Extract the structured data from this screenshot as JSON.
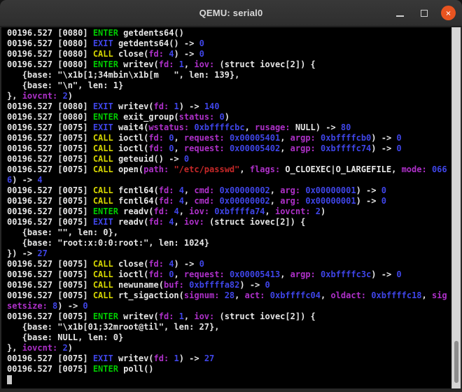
{
  "window": {
    "title": "QEMU: serial0",
    "controls": {
      "minimize": "minimize",
      "maximize": "maximize",
      "close_glyph": "✕"
    }
  },
  "colors": {
    "terminal_background": "#000000",
    "titlebar": "#2e2e2e",
    "text_default": "#e6e6e6",
    "enter_green": "#00cb00",
    "exit_blue": "#3f45e8",
    "call_yellow": "#d4d400",
    "param_magenta": "#ae30c9",
    "string_red": "#c62828",
    "close_button": "#e95420",
    "scrollbar_track": "#d6d6d6",
    "scrollbar_thumb": "#8e8e8e",
    "cursor": "#c9c9c9"
  },
  "terminal": {
    "cursor_visible": true,
    "lines": [
      [
        [
          "w",
          "00196.527 [0080] "
        ],
        [
          "g",
          "ENTER"
        ],
        [
          "w",
          " getdents64()"
        ]
      ],
      [
        [
          "w",
          "00196.527 [0080] "
        ],
        [
          "b",
          "EXIT"
        ],
        [
          "w",
          " getdents64() -> "
        ],
        [
          "b",
          "0"
        ]
      ],
      [
        [
          "w",
          "00196.527 [0080] "
        ],
        [
          "y",
          "CALL"
        ],
        [
          "w",
          " close("
        ],
        [
          "m",
          "fd:"
        ],
        [
          "w",
          " "
        ],
        [
          "b",
          "4"
        ],
        [
          "w",
          ") -> "
        ],
        [
          "b",
          "0"
        ]
      ],
      [
        [
          "w",
          "00196.527 [0080] "
        ],
        [
          "g",
          "ENTER"
        ],
        [
          "w",
          " writev("
        ],
        [
          "m",
          "fd:"
        ],
        [
          "w",
          " "
        ],
        [
          "b",
          "1"
        ],
        [
          "w",
          ", "
        ],
        [
          "m",
          "iov:"
        ],
        [
          "w",
          " (struct iovec[2]) {"
        ]
      ],
      [
        [
          "w",
          "   {base: \"\\x1b[1;34mbin\\x1b[m   \", len: 139},"
        ]
      ],
      [
        [
          "w",
          "   {base: \"\\n\", len: 1}"
        ]
      ],
      [
        [
          "w",
          "}, "
        ],
        [
          "m",
          "iovcnt:"
        ],
        [
          "w",
          " "
        ],
        [
          "b",
          "2"
        ],
        [
          "w",
          ")"
        ]
      ],
      [
        [
          "w",
          "00196.527 [0080] "
        ],
        [
          "b",
          "EXIT"
        ],
        [
          "w",
          " writev("
        ],
        [
          "m",
          "fd:"
        ],
        [
          "w",
          " "
        ],
        [
          "b",
          "1"
        ],
        [
          "w",
          ") -> "
        ],
        [
          "b",
          "140"
        ]
      ],
      [
        [
          "w",
          "00196.527 [0080] "
        ],
        [
          "g",
          "ENTER"
        ],
        [
          "w",
          " exit_group("
        ],
        [
          "m",
          "status:"
        ],
        [
          "w",
          " "
        ],
        [
          "b",
          "0"
        ],
        [
          "w",
          ")"
        ]
      ],
      [
        [
          "w",
          "00196.527 [0075] "
        ],
        [
          "b",
          "EXIT"
        ],
        [
          "w",
          " wait4("
        ],
        [
          "m",
          "wstatus:"
        ],
        [
          "w",
          " "
        ],
        [
          "b",
          "0xbffffcbc"
        ],
        [
          "w",
          ", "
        ],
        [
          "m",
          "rusage:"
        ],
        [
          "w",
          " NULL) -> "
        ],
        [
          "b",
          "80"
        ]
      ],
      [
        [
          "w",
          "00196.527 [0075] "
        ],
        [
          "y",
          "CALL"
        ],
        [
          "w",
          " ioctl("
        ],
        [
          "m",
          "fd:"
        ],
        [
          "w",
          " "
        ],
        [
          "b",
          "0"
        ],
        [
          "w",
          ", "
        ],
        [
          "m",
          "request:"
        ],
        [
          "w",
          " "
        ],
        [
          "b",
          "0x00005401"
        ],
        [
          "w",
          ", "
        ],
        [
          "m",
          "argp:"
        ],
        [
          "w",
          " "
        ],
        [
          "b",
          "0xbffffcb0"
        ],
        [
          "w",
          ") -> "
        ],
        [
          "b",
          "0"
        ]
      ],
      [
        [
          "w",
          "00196.527 [0075] "
        ],
        [
          "y",
          "CALL"
        ],
        [
          "w",
          " ioctl("
        ],
        [
          "m",
          "fd:"
        ],
        [
          "w",
          " "
        ],
        [
          "b",
          "0"
        ],
        [
          "w",
          ", "
        ],
        [
          "m",
          "request:"
        ],
        [
          "w",
          " "
        ],
        [
          "b",
          "0x00005402"
        ],
        [
          "w",
          ", "
        ],
        [
          "m",
          "argp:"
        ],
        [
          "w",
          " "
        ],
        [
          "b",
          "0xbffffc74"
        ],
        [
          "w",
          ") -> "
        ],
        [
          "b",
          "0"
        ]
      ],
      [
        [
          "w",
          "00196.527 [0075] "
        ],
        [
          "y",
          "CALL"
        ],
        [
          "w",
          " geteuid() -> "
        ],
        [
          "b",
          "0"
        ]
      ],
      [
        [
          "w",
          "00196.527 [0075] "
        ],
        [
          "y",
          "CALL"
        ],
        [
          "w",
          " open("
        ],
        [
          "m",
          "path:"
        ],
        [
          "w",
          " "
        ],
        [
          "r",
          "\"/etc/passwd\""
        ],
        [
          "w",
          ", "
        ],
        [
          "m",
          "flags:"
        ],
        [
          "w",
          " O_CLOEXEC|O_LARGEFILE, "
        ],
        [
          "m",
          "mode:"
        ],
        [
          "w",
          " "
        ],
        [
          "b",
          "066"
        ]
      ],
      [
        [
          "b",
          "6"
        ],
        [
          "w",
          ") -> "
        ],
        [
          "b",
          "4"
        ]
      ],
      [
        [
          "w",
          "00196.527 [0075] "
        ],
        [
          "y",
          "CALL"
        ],
        [
          "w",
          " fcntl64("
        ],
        [
          "m",
          "fd:"
        ],
        [
          "w",
          " "
        ],
        [
          "b",
          "4"
        ],
        [
          "w",
          ", "
        ],
        [
          "m",
          "cmd:"
        ],
        [
          "w",
          " "
        ],
        [
          "b",
          "0x00000002"
        ],
        [
          "w",
          ", "
        ],
        [
          "m",
          "arg:"
        ],
        [
          "w",
          " "
        ],
        [
          "b",
          "0x00000001"
        ],
        [
          "w",
          ") -> "
        ],
        [
          "b",
          "0"
        ]
      ],
      [
        [
          "w",
          "00196.527 [0075] "
        ],
        [
          "y",
          "CALL"
        ],
        [
          "w",
          " fcntl64("
        ],
        [
          "m",
          "fd:"
        ],
        [
          "w",
          " "
        ],
        [
          "b",
          "4"
        ],
        [
          "w",
          ", "
        ],
        [
          "m",
          "cmd:"
        ],
        [
          "w",
          " "
        ],
        [
          "b",
          "0x00000002"
        ],
        [
          "w",
          ", "
        ],
        [
          "m",
          "arg:"
        ],
        [
          "w",
          " "
        ],
        [
          "b",
          "0x00000001"
        ],
        [
          "w",
          ") -> "
        ],
        [
          "b",
          "0"
        ]
      ],
      [
        [
          "w",
          "00196.527 [0075] "
        ],
        [
          "g",
          "ENTER"
        ],
        [
          "w",
          " readv("
        ],
        [
          "m",
          "fd:"
        ],
        [
          "w",
          " "
        ],
        [
          "b",
          "4"
        ],
        [
          "w",
          ", "
        ],
        [
          "m",
          "iov:"
        ],
        [
          "w",
          " "
        ],
        [
          "b",
          "0xbffffa74"
        ],
        [
          "w",
          ", "
        ],
        [
          "m",
          "iovcnt:"
        ],
        [
          "w",
          " "
        ],
        [
          "b",
          "2"
        ],
        [
          "w",
          ")"
        ]
      ],
      [
        [
          "w",
          "00196.527 [0075] "
        ],
        [
          "b",
          "EXIT"
        ],
        [
          "w",
          " readv("
        ],
        [
          "m",
          "fd:"
        ],
        [
          "w",
          " "
        ],
        [
          "b",
          "4"
        ],
        [
          "w",
          ", "
        ],
        [
          "m",
          "iov:"
        ],
        [
          "w",
          " (struct iovec[2]) {"
        ]
      ],
      [
        [
          "w",
          "   {base: \"\", len: 0},"
        ]
      ],
      [
        [
          "w",
          "   {base: \"root:x:0:0:root:\", len: 1024}"
        ]
      ],
      [
        [
          "w",
          "}) -> "
        ],
        [
          "b",
          "27"
        ]
      ],
      [
        [
          "w",
          "00196.527 [0075] "
        ],
        [
          "y",
          "CALL"
        ],
        [
          "w",
          " close("
        ],
        [
          "m",
          "fd:"
        ],
        [
          "w",
          " "
        ],
        [
          "b",
          "4"
        ],
        [
          "w",
          ") -> "
        ],
        [
          "b",
          "0"
        ]
      ],
      [
        [
          "w",
          "00196.527 [0075] "
        ],
        [
          "y",
          "CALL"
        ],
        [
          "w",
          " ioctl("
        ],
        [
          "m",
          "fd:"
        ],
        [
          "w",
          " "
        ],
        [
          "b",
          "0"
        ],
        [
          "w",
          ", "
        ],
        [
          "m",
          "request:"
        ],
        [
          "w",
          " "
        ],
        [
          "b",
          "0x00005413"
        ],
        [
          "w",
          ", "
        ],
        [
          "m",
          "argp:"
        ],
        [
          "w",
          " "
        ],
        [
          "b",
          "0xbffffc3c"
        ],
        [
          "w",
          ") -> "
        ],
        [
          "b",
          "0"
        ]
      ],
      [
        [
          "w",
          "00196.527 [0075] "
        ],
        [
          "y",
          "CALL"
        ],
        [
          "w",
          " newuname("
        ],
        [
          "m",
          "buf:"
        ],
        [
          "w",
          " "
        ],
        [
          "b",
          "0xbffffa82"
        ],
        [
          "w",
          ") -> "
        ],
        [
          "b",
          "0"
        ]
      ],
      [
        [
          "w",
          "00196.527 [0075] "
        ],
        [
          "y",
          "CALL"
        ],
        [
          "w",
          " rt_sigaction("
        ],
        [
          "m",
          "signum:"
        ],
        [
          "w",
          " "
        ],
        [
          "b",
          "28"
        ],
        [
          "w",
          ", "
        ],
        [
          "m",
          "act:"
        ],
        [
          "w",
          " "
        ],
        [
          "b",
          "0xbffffc04"
        ],
        [
          "w",
          ", "
        ],
        [
          "m",
          "oldact:"
        ],
        [
          "w",
          " "
        ],
        [
          "b",
          "0xbffffc18"
        ],
        [
          "w",
          ", "
        ],
        [
          "m",
          "sig"
        ]
      ],
      [
        [
          "m",
          "setsize:"
        ],
        [
          "w",
          " "
        ],
        [
          "b",
          "8"
        ],
        [
          "w",
          ") -> "
        ],
        [
          "b",
          "0"
        ]
      ],
      [
        [
          "w",
          "00196.527 [0075] "
        ],
        [
          "g",
          "ENTER"
        ],
        [
          "w",
          " writev("
        ],
        [
          "m",
          "fd:"
        ],
        [
          "w",
          " "
        ],
        [
          "b",
          "1"
        ],
        [
          "w",
          ", "
        ],
        [
          "m",
          "iov:"
        ],
        [
          "w",
          " (struct iovec[2]) {"
        ]
      ],
      [
        [
          "w",
          "   {base: \"\\x1b[01;32mroot@til\", len: 27},"
        ]
      ],
      [
        [
          "w",
          "   {base: NULL, len: 0}"
        ]
      ],
      [
        [
          "w",
          "}, "
        ],
        [
          "m",
          "iovcnt:"
        ],
        [
          "w",
          " "
        ],
        [
          "b",
          "2"
        ],
        [
          "w",
          ")"
        ]
      ],
      [
        [
          "w",
          "00196.527 [0075] "
        ],
        [
          "b",
          "EXIT"
        ],
        [
          "w",
          " writev("
        ],
        [
          "m",
          "fd:"
        ],
        [
          "w",
          " "
        ],
        [
          "b",
          "1"
        ],
        [
          "w",
          ") -> "
        ],
        [
          "b",
          "27"
        ]
      ],
      [
        [
          "w",
          "00196.527 [0075] "
        ],
        [
          "g",
          "ENTER"
        ],
        [
          "w",
          " poll()"
        ]
      ]
    ]
  }
}
